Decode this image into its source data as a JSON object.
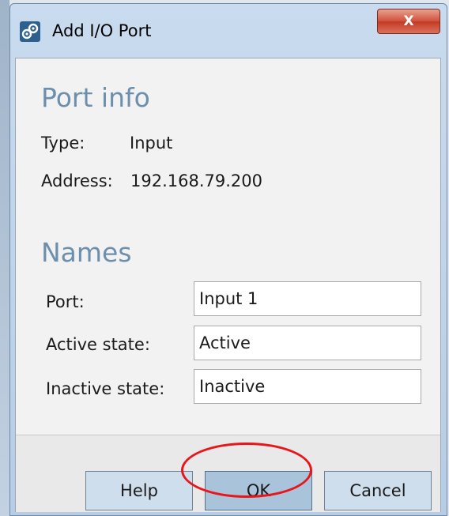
{
  "window": {
    "title": "Add I/O Port",
    "close_label": "X",
    "icon": "gear-link-icon"
  },
  "port_info": {
    "heading": "Port info",
    "type_label": "Type:",
    "type_value": "Input",
    "address_label": "Address:",
    "address_value": "192.168.79.200"
  },
  "names": {
    "heading": "Names",
    "fields": [
      {
        "label": "Port:",
        "value": "Input 1"
      },
      {
        "label": "Active state:",
        "value": "Active"
      },
      {
        "label": "Inactive state:",
        "value": "Inactive"
      }
    ]
  },
  "buttons": {
    "help": "Help",
    "ok": "OK",
    "cancel": "Cancel"
  },
  "colors": {
    "heading": "#6b8fad",
    "highlight_ring": "#e8161a",
    "close_button": "#c43b25"
  }
}
